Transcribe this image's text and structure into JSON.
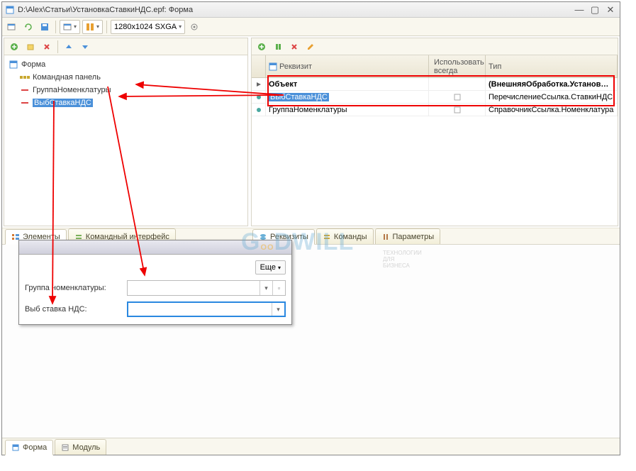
{
  "window": {
    "title": "D:\\Alex\\Статьи\\УстановкаСтавкиНДС.epf: Форма",
    "resolution": "1280x1024 SXGA"
  },
  "left_panel": {
    "root": "Форма",
    "items": [
      "Командная панель",
      "ГруппаНоменклатуры",
      "ВыбСтавкаНДС"
    ]
  },
  "right_panel": {
    "headers": {
      "col1": "Реквизит",
      "col2": "Использовать всегда",
      "col3": "Тип"
    },
    "rows": [
      {
        "name": "Объект",
        "type": "(ВнешняяОбработка.Установ…",
        "bold": true
      },
      {
        "name": "ВыбСтавкаНДС",
        "type": "ПеречислениеСсылка.СтавкиНДС"
      },
      {
        "name": "ГруппаНоменклатуры",
        "type": "СправочникСсылка.Номенклатура"
      }
    ]
  },
  "left_tabs": [
    "Элементы",
    "Командный интерфейс"
  ],
  "right_tabs": [
    "Реквизиты",
    "Команды",
    "Параметры"
  ],
  "preview": {
    "more_btn": "Еще",
    "field1_label": "Группа номенклатуры:",
    "field2_label": "Выб ставка НДС:"
  },
  "bottom_tabs": [
    "Форма",
    "Модуль"
  ],
  "watermark": "GOODWILL",
  "watermark_sub": "ТЕХНОЛОГИИ ДЛЯ БИЗНЕСА"
}
